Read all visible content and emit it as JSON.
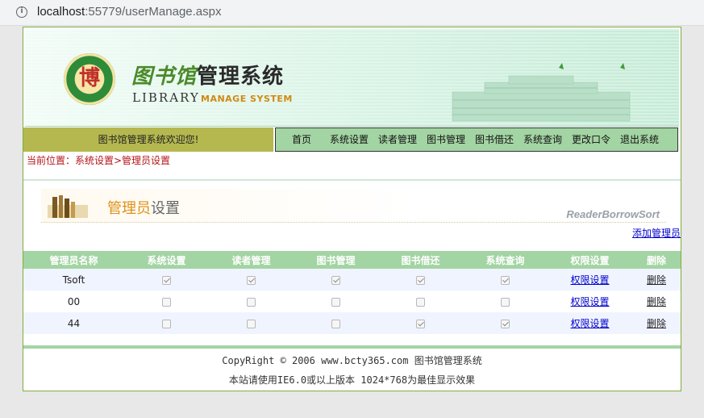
{
  "browser": {
    "url_host": "localhost",
    "url_path": ":55779/userManage.aspx",
    "info_icon": "info-icon"
  },
  "header": {
    "logo_cn_calligraphy": "图书馆",
    "logo_cn": "管理系统",
    "logo_en_library": "LIBRARY",
    "logo_en_manage": "MANAGE SYSTEM",
    "seal_char": "博"
  },
  "welcome": "图书馆管理系统欢迎您!",
  "nav": [
    "首页",
    "系统设置",
    "读者管理",
    "图书管理",
    "图书借还",
    "系统查询",
    "更改口令",
    "退出系统"
  ],
  "breadcrumb": "当前位置：系统设置>管理员设置",
  "section": {
    "title_a": "管理员",
    "title_b": "设置",
    "tag": "ReaderBorrowSort"
  },
  "add_admin": "添加管理员",
  "table": {
    "headers": [
      "管理员名称",
      "系统设置",
      "读者管理",
      "图书管理",
      "图书借还",
      "系统查询",
      "权限设置",
      "删除"
    ],
    "rows": [
      {
        "name": "Tsoft",
        "perms": [
          true,
          true,
          true,
          true,
          true
        ],
        "perm_link": "权限设置",
        "del": "删除"
      },
      {
        "name": "00",
        "perms": [
          false,
          false,
          false,
          false,
          false
        ],
        "perm_link": "权限设置",
        "del": "删除"
      },
      {
        "name": "44",
        "perms": [
          false,
          false,
          false,
          true,
          true
        ],
        "perm_link": "权限设置",
        "del": "删除"
      }
    ]
  },
  "footer": {
    "line1": "CopyRight © 2006 www.bcty365.com 图书馆管理系统",
    "line2": "本站请使用IE6.0或以上版本 1024*768为最佳显示效果"
  },
  "colors": {
    "nav_bg": "#a3d4a3",
    "welcome_bg": "#b5b84f",
    "breadcrumb": "#b4151b",
    "link": "#0000cc"
  }
}
